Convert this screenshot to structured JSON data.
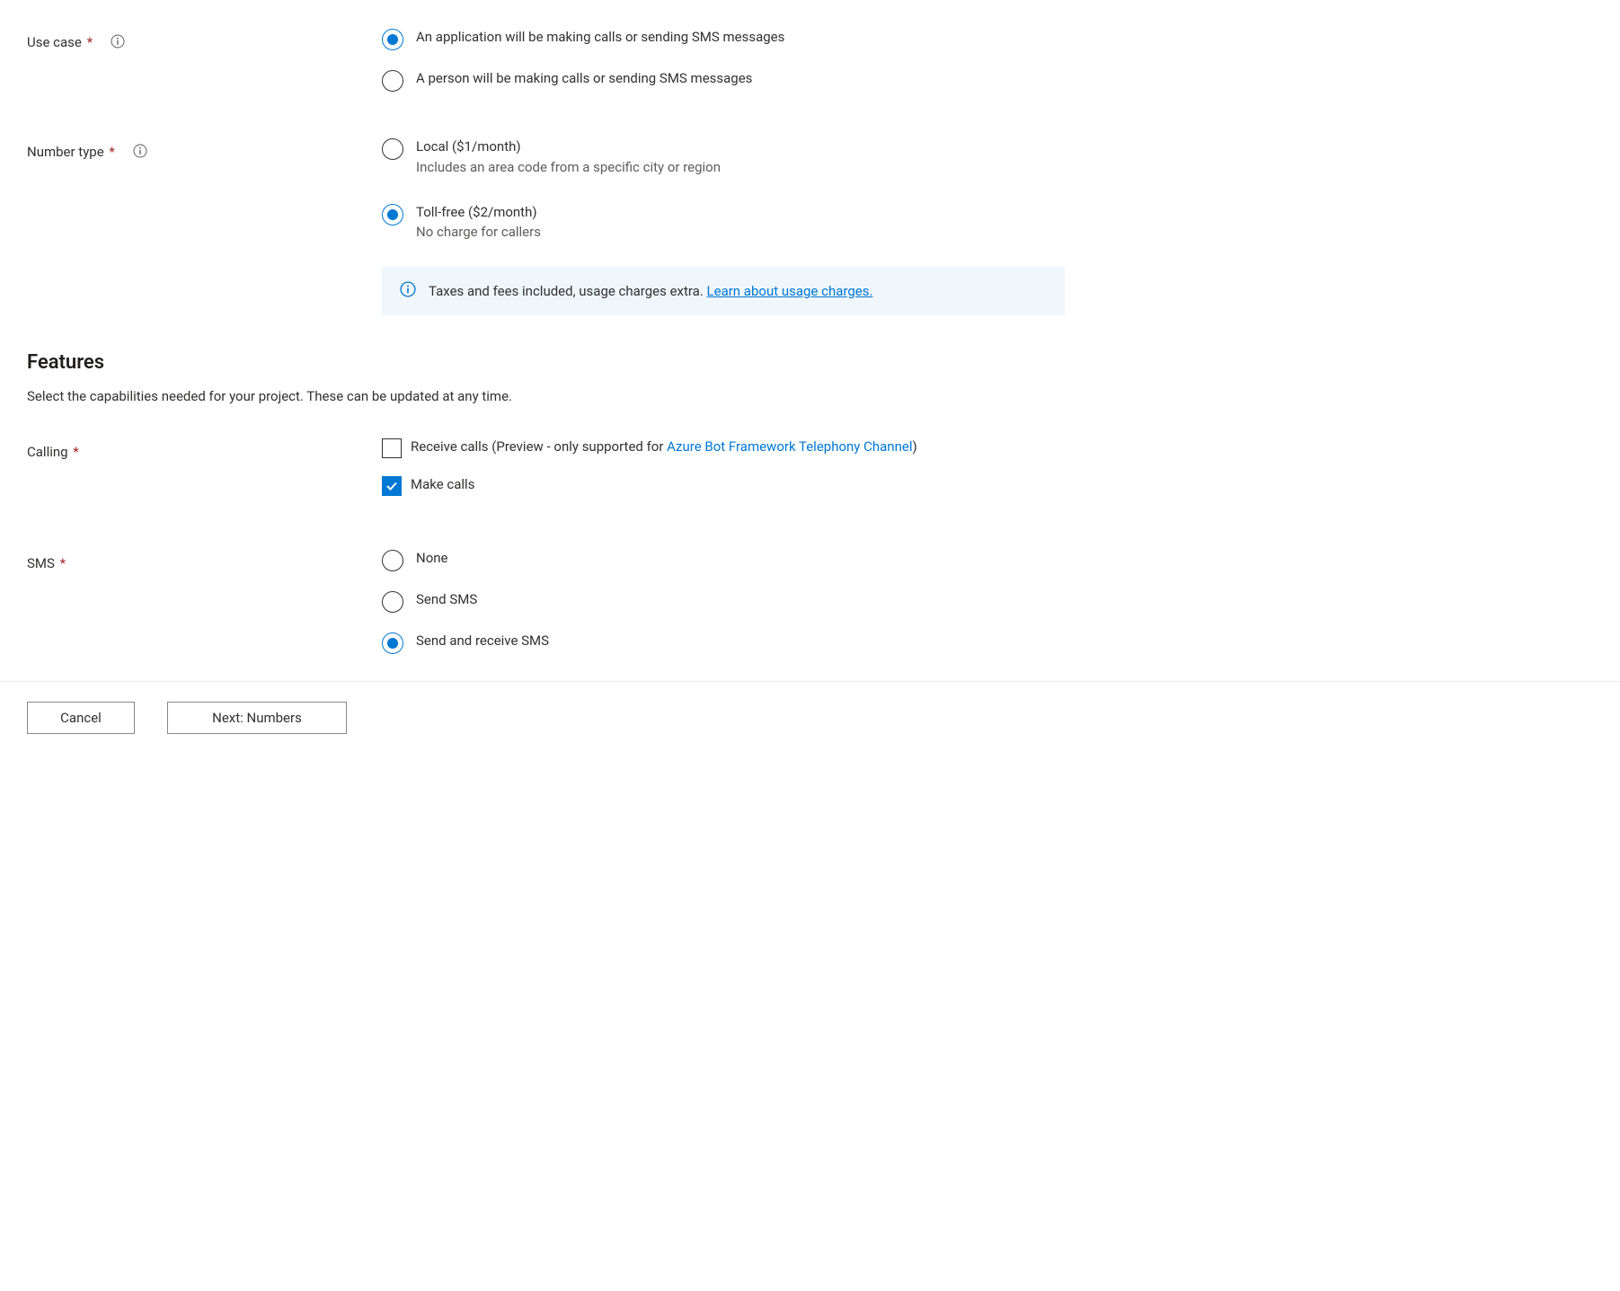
{
  "useCase": {
    "label": "Use case",
    "options": {
      "application": "An application will be making calls or sending SMS messages",
      "person": "A person will be making calls or sending SMS messages"
    }
  },
  "numberType": {
    "label": "Number type",
    "local": {
      "label": "Local ($1/month)",
      "desc": "Includes an area code from a specific city or region"
    },
    "tollfree": {
      "label": "Toll-free ($2/month)",
      "desc": "No charge for callers"
    }
  },
  "infoBanner": {
    "text": "Taxes and fees included, usage charges extra. ",
    "link": "Learn about usage charges."
  },
  "features": {
    "heading": "Features",
    "subtext": "Select the capabilities needed for your project. These can be updated at any time."
  },
  "calling": {
    "label": "Calling",
    "receive": {
      "prefix": "Receive calls (Preview - only supported for ",
      "link": "Azure Bot Framework Telephony Channel",
      "suffix": ")"
    },
    "make": "Make calls"
  },
  "sms": {
    "label": "SMS",
    "none": "None",
    "send": "Send SMS",
    "sendReceive": "Send and receive SMS"
  },
  "buttons": {
    "cancel": "Cancel",
    "next": "Next: Numbers"
  }
}
